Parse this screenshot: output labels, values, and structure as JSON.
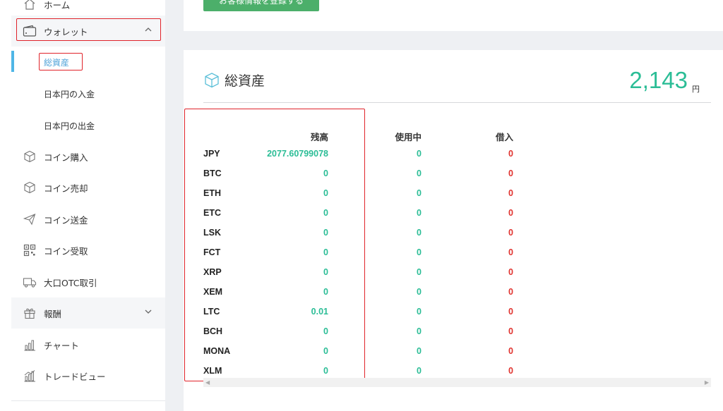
{
  "sidebar": {
    "home_label": "ホーム",
    "wallet_label": "ウォレット",
    "sub_items": [
      "総資産",
      "日本円の入金",
      "日本円の出金"
    ],
    "items": [
      {
        "label": "コイン購入",
        "icon": "cube-icon"
      },
      {
        "label": "コイン売却",
        "icon": "cube-icon"
      },
      {
        "label": "コイン送金",
        "icon": "paper-plane-icon"
      },
      {
        "label": "コイン受取",
        "icon": "qr-code-icon"
      },
      {
        "label": "大口OTC取引",
        "icon": "truck-icon"
      },
      {
        "label": "報酬",
        "icon": "gift-icon"
      },
      {
        "label": "チャート",
        "icon": "bar-chart-icon"
      },
      {
        "label": "トレードビュー",
        "icon": "bar-chart-icon"
      }
    ]
  },
  "main": {
    "register_button": "お客様情報を登録する",
    "title": "総資産",
    "total_value": "2,143",
    "total_unit": "円",
    "table": {
      "headers": [
        "残高",
        "使用中",
        "借入"
      ],
      "rows": [
        {
          "symbol": "JPY",
          "balance": "2077.60799078",
          "in_use": "0",
          "borrowed": "0"
        },
        {
          "symbol": "BTC",
          "balance": "0",
          "in_use": "0",
          "borrowed": "0"
        },
        {
          "symbol": "ETH",
          "balance": "0",
          "in_use": "0",
          "borrowed": "0"
        },
        {
          "symbol": "ETC",
          "balance": "0",
          "in_use": "0",
          "borrowed": "0"
        },
        {
          "symbol": "LSK",
          "balance": "0",
          "in_use": "0",
          "borrowed": "0"
        },
        {
          "symbol": "FCT",
          "balance": "0",
          "in_use": "0",
          "borrowed": "0"
        },
        {
          "symbol": "XRP",
          "balance": "0",
          "in_use": "0",
          "borrowed": "0"
        },
        {
          "symbol": "XEM",
          "balance": "0",
          "in_use": "0",
          "borrowed": "0"
        },
        {
          "symbol": "LTC",
          "balance": "0.01",
          "in_use": "0",
          "borrowed": "0"
        },
        {
          "symbol": "BCH",
          "balance": "0",
          "in_use": "0",
          "borrowed": "0"
        },
        {
          "symbol": "MONA",
          "balance": "0",
          "in_use": "0",
          "borrowed": "0"
        },
        {
          "symbol": "XLM",
          "balance": "0",
          "in_use": "0",
          "borrowed": "0"
        }
      ]
    }
  },
  "colors": {
    "accent": "#2bbd96",
    "negative": "#e0322e",
    "button": "#4caf6a",
    "active": "#4fb6e6",
    "highlight_box": "#e0232a"
  }
}
